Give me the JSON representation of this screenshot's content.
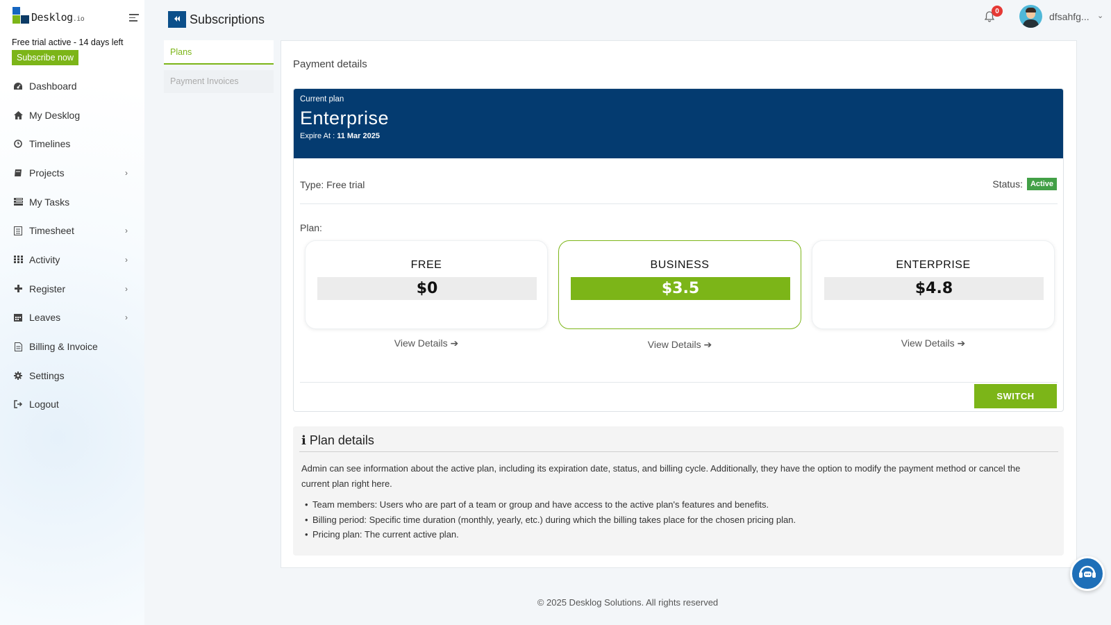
{
  "brand": {
    "name": "Desklog",
    "tld": ".io"
  },
  "trial": {
    "text": "Free trial active - 14 days left",
    "subscribe_label": "Subscribe now"
  },
  "sidebar": {
    "items": [
      {
        "label": "Dashboard",
        "icon": "dashboard-icon",
        "chevron": false
      },
      {
        "label": "My Desklog",
        "icon": "home-icon",
        "chevron": false
      },
      {
        "label": "Timelines",
        "icon": "clock-icon",
        "chevron": false
      },
      {
        "label": "Projects",
        "icon": "book-icon",
        "chevron": true
      },
      {
        "label": "My Tasks",
        "icon": "tasks-icon",
        "chevron": false
      },
      {
        "label": "Timesheet",
        "icon": "timesheet-icon",
        "chevron": true
      },
      {
        "label": "Activity",
        "icon": "grid-icon",
        "chevron": true
      },
      {
        "label": "Register",
        "icon": "plus-icon",
        "chevron": true
      },
      {
        "label": "Leaves",
        "icon": "calendar-icon",
        "chevron": true
      },
      {
        "label": "Billing & Invoice",
        "icon": "invoice-icon",
        "chevron": false
      },
      {
        "label": "Settings",
        "icon": "gear-icon",
        "chevron": false
      },
      {
        "label": "Logout",
        "icon": "logout-icon",
        "chevron": false
      }
    ]
  },
  "header": {
    "title": "Subscriptions",
    "notification_count": "0",
    "username": "dfsahfg..."
  },
  "tabs": {
    "plans": "Plans",
    "invoices": "Payment Invoices"
  },
  "payment": {
    "title": "Payment details",
    "current_label": "Current plan",
    "current_plan": "Enterprise",
    "expire_label": "Expire At : ",
    "expire_date": "11 Mar 2025",
    "type_text": "Type: Free trial",
    "status_label": "Status:",
    "status_value": "Active",
    "plan_label": "Plan:",
    "tiers": [
      {
        "name": "FREE",
        "price": "$0",
        "details": "View Details"
      },
      {
        "name": "BUSINESS",
        "price": "$3.5",
        "details": "View Details"
      },
      {
        "name": "ENTERPRISE",
        "price": "$4.8",
        "details": "View Details"
      }
    ],
    "switch_label": "SWITCH"
  },
  "plan_details": {
    "title": "Plan details",
    "description": "Admin can see information about the active plan, including its expiration date, status, and billing cycle. Additionally, they have the option to modify the payment method or cancel the current plan right here.",
    "bullets": [
      "Team members: Users who are part of a team or group and have access to the active plan's features and benefits.",
      "Billing period: Specific time duration (monthly, yearly, etc.) during which the billing takes place for the chosen pricing plan.",
      "Pricing plan: The current active plan."
    ]
  },
  "footer": {
    "text": "© 2025 Desklog Solutions. All rights reserved"
  },
  "colors": {
    "accent": "#7cb518",
    "banner": "#043b70",
    "primary": "#0b4f8a",
    "status": "#43a047"
  }
}
